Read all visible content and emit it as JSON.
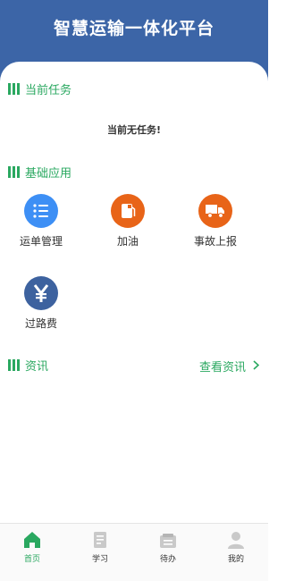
{
  "header": {
    "title": "智慧运输一体化平台"
  },
  "sections": {
    "current_task": {
      "title": "当前任务",
      "empty_text": "当前无任务!"
    },
    "basic_apps": {
      "title": "基础应用",
      "items": [
        {
          "label": "运单管理",
          "icon": "list-icon",
          "color": "#3d8ff5"
        },
        {
          "label": "加油",
          "icon": "fuel-icon",
          "color": "#e86418"
        },
        {
          "label": "事故上报",
          "icon": "truck-icon",
          "color": "#e86418"
        },
        {
          "label": "过路费",
          "icon": "yen-icon",
          "color": "#3d629f"
        }
      ]
    },
    "news": {
      "title": "资讯",
      "link_label": "查看资讯",
      "link_icon": "chevron-right-icon"
    }
  },
  "tabbar": {
    "active_color": "#2aa860",
    "tabs": [
      {
        "label": "首页",
        "icon": "home-icon",
        "active": true
      },
      {
        "label": "学习",
        "icon": "book-icon",
        "active": false
      },
      {
        "label": "待办",
        "icon": "inbox-icon",
        "active": false
      },
      {
        "label": "我的",
        "icon": "user-icon",
        "active": false
      }
    ]
  }
}
